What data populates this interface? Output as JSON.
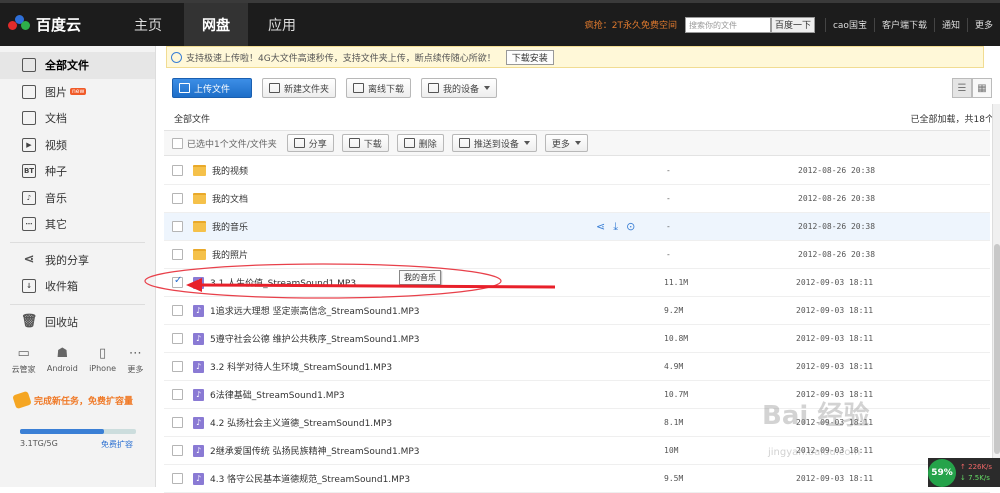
{
  "topnav": {
    "logo": "百度云",
    "tabs": [
      "主页",
      "网盘",
      "应用"
    ],
    "promo": "疯抢：2T永久免费空间",
    "search_placeholder": "搜索你的文件",
    "search_button": "百度一下",
    "links": [
      "cao国宝",
      "客户端下载",
      "通知",
      "更多"
    ]
  },
  "sidebar": {
    "items": [
      {
        "label": "全部文件",
        "icon": "folder-icon"
      },
      {
        "label": "图片",
        "icon": "image-icon",
        "badge": "new"
      },
      {
        "label": "文档",
        "icon": "document-icon"
      },
      {
        "label": "视频",
        "icon": "video-icon"
      },
      {
        "label": "种子",
        "icon": "bt-icon",
        "glyph": "BT"
      },
      {
        "label": "音乐",
        "icon": "music-icon"
      },
      {
        "label": "其它",
        "icon": "other-icon"
      }
    ],
    "share": "我的分享",
    "inbox": "收件箱",
    "recycle": "回收站",
    "devices": [
      "云管家",
      "Android",
      "iPhone",
      "更多"
    ],
    "task_banner": "完成新任务，免费扩容量",
    "quota": {
      "used": "3.1TG/5G",
      "upgrade": "免费扩容",
      "fill_fraction": 0.72
    }
  },
  "notice": {
    "text": "支持极速上传啦！4G大文件高速秒传，支持文件夹上传，断点续传随心所欲！",
    "button": "下载安装"
  },
  "toolbar": {
    "upload": "上传文件",
    "new_folder": "新建文件夹",
    "offline_download": "离线下载",
    "my_device": "我的设备"
  },
  "breadcrumb": "全部文件",
  "loaded_status": "已全部加载，共18个",
  "selection": {
    "label": "已选中1个文件/文件夹",
    "share": "分享",
    "download": "下载",
    "delete": "删除",
    "push": "推送到设备",
    "more": "更多"
  },
  "tooltip": "我的音乐",
  "files": [
    {
      "name": "我的视频",
      "size": "-",
      "date": "2012-08-26 20:38",
      "type": "folder"
    },
    {
      "name": "我的文档",
      "size": "-",
      "date": "2012-08-26 20:38",
      "type": "folder"
    },
    {
      "name": "我的音乐",
      "size": "-",
      "date": "2012-08-26 20:38",
      "type": "folder"
    },
    {
      "name": "我的照片",
      "size": "-",
      "date": "2012-08-26 20:38",
      "type": "folder"
    },
    {
      "name": "3.1 人生价值_StreamSound1.MP3",
      "size": "11.1M",
      "date": "2012-09-03 18:11",
      "type": "music"
    },
    {
      "name": "1追求远大理想 坚定崇高信念_StreamSound1.MP3",
      "size": "9.2M",
      "date": "2012-09-03 18:11",
      "type": "music"
    },
    {
      "name": "5遵守社会公德 维护公共秩序_StreamSound1.MP3",
      "size": "10.8M",
      "date": "2012-09-03 18:11",
      "type": "music"
    },
    {
      "name": "3.2 科学对待人生环境_StreamSound1.MP3",
      "size": "4.9M",
      "date": "2012-09-03 18:11",
      "type": "music"
    },
    {
      "name": "6法律基础_StreamSound1.MP3",
      "size": "10.7M",
      "date": "2012-09-03 18:11",
      "type": "music"
    },
    {
      "name": "4.2 弘扬社会主义道德_StreamSound1.MP3",
      "size": "8.1M",
      "date": "2012-09-03 18:11",
      "type": "music"
    },
    {
      "name": "2继承爱国传统 弘扬民族精神_StreamSound1.MP3",
      "size": "10M",
      "date": "2012-09-03 18:11",
      "type": "music"
    },
    {
      "name": "4.3 恪守公民基本道德规范_StreamSound1.MP3",
      "size": "9.5M",
      "date": "2012-09-03 18:11",
      "type": "music"
    }
  ],
  "watermark": {
    "main": "Bai 经验",
    "sub": "jingyan.baidu.com"
  },
  "speed": {
    "percent": "59%",
    "up": "226K/s",
    "down": "7.5K/s"
  }
}
